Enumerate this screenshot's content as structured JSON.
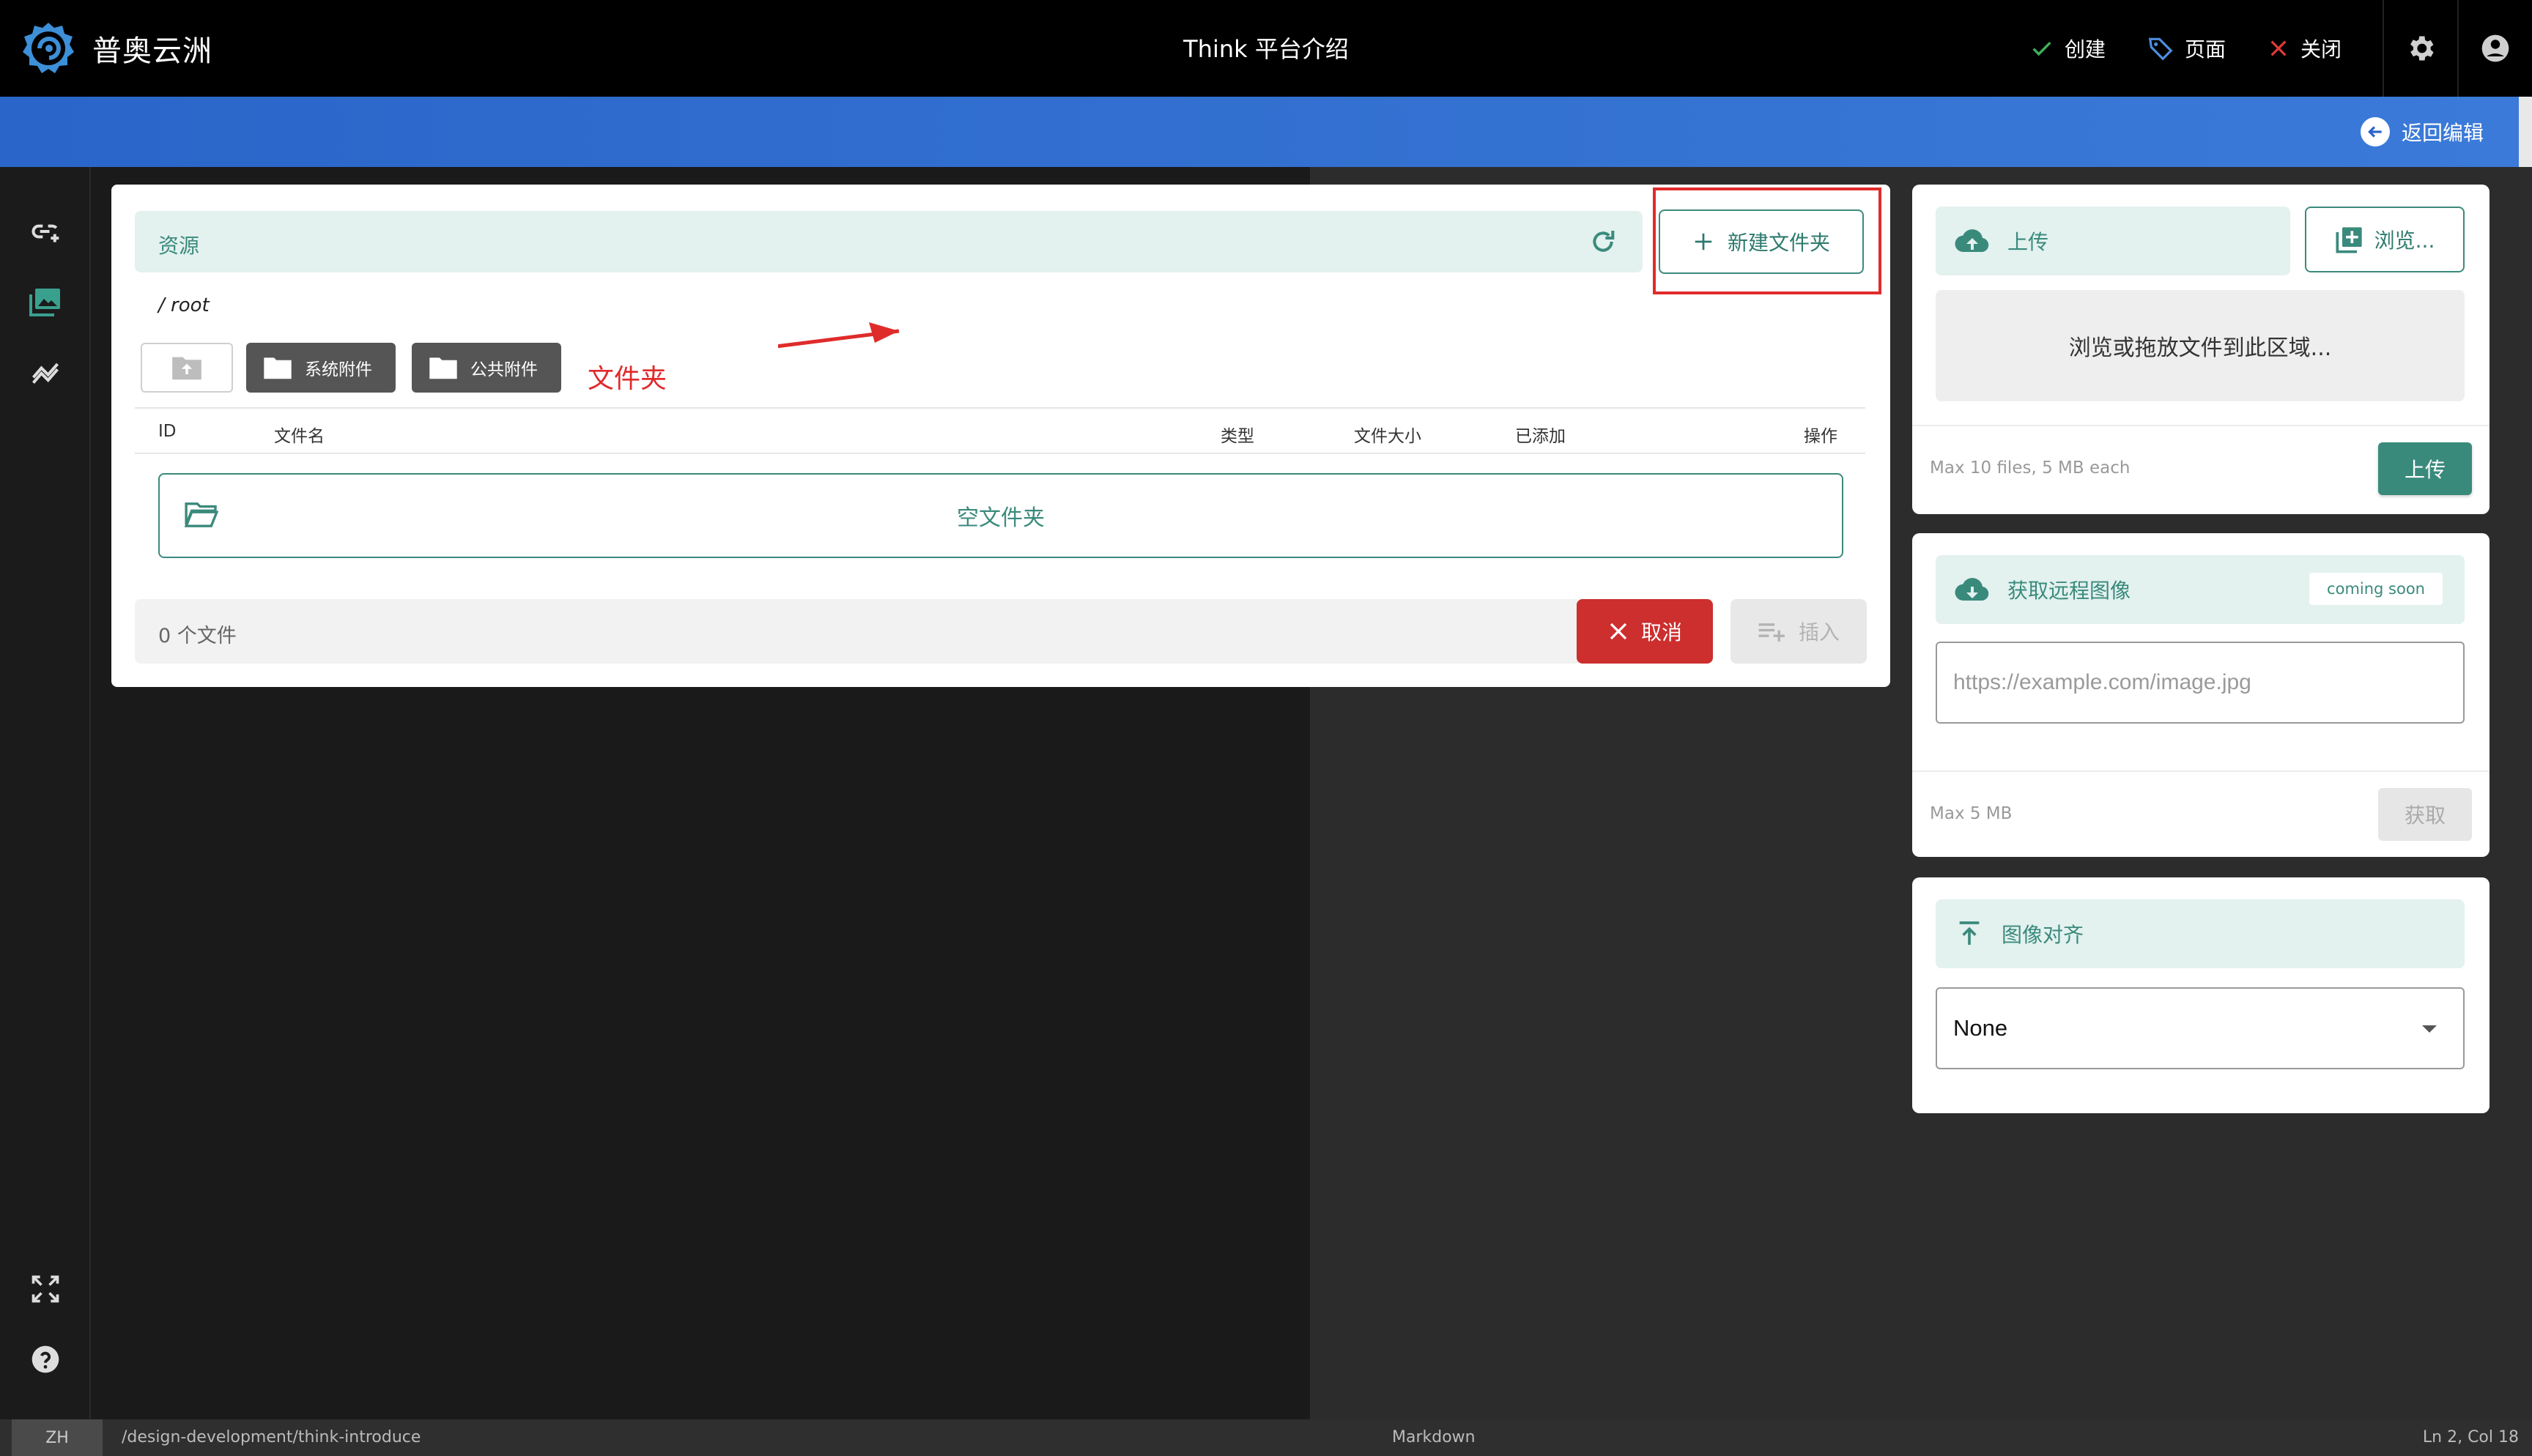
{
  "header": {
    "brand_name": "普奥云洲",
    "page_title": "Think 平台介绍",
    "actions": [
      {
        "label": "创建",
        "icon": "check-icon"
      },
      {
        "label": "页面",
        "icon": "tag-icon"
      },
      {
        "label": "关闭",
        "icon": "close-icon"
      }
    ],
    "back_edit_label": "返回编辑"
  },
  "dialog": {
    "resource_label": "资源",
    "new_folder_label": "新建文件夹",
    "breadcrumb": "/ root",
    "folders": [
      "系统附件",
      "公共附件"
    ],
    "annotation_text": "文件夹",
    "columns": {
      "id": "ID",
      "filename": "文件名",
      "type": "类型",
      "size": "文件大小",
      "added": "已添加",
      "actions": "操作"
    },
    "empty_folder_label": "空文件夹",
    "file_count": "0 个文件",
    "cancel_label": "取消",
    "insert_label": "插入"
  },
  "upload_card": {
    "title": "上传",
    "browse_label": "浏览...",
    "dropzone_text": "浏览或拖放文件到此区域...",
    "note": "Max 10 files, 5 MB each",
    "upload_label": "上传"
  },
  "remote_card": {
    "title": "获取远程图像",
    "badge": "coming soon",
    "url_placeholder": "https://example.com/image.jpg",
    "note": "Max 5 MB",
    "fetch_label": "获取"
  },
  "align_card": {
    "title": "图像对齐",
    "selected": "None"
  },
  "statusbar": {
    "lang": "ZH",
    "path": "/design-development/think-introduce",
    "mode": "Markdown",
    "position": "Ln 2, Col 18"
  },
  "colors": {
    "accent": "#3a8a7c",
    "accent_bg": "#e3f1ef",
    "danger": "#cd2e2e",
    "header_blue": "#2a66c9"
  }
}
